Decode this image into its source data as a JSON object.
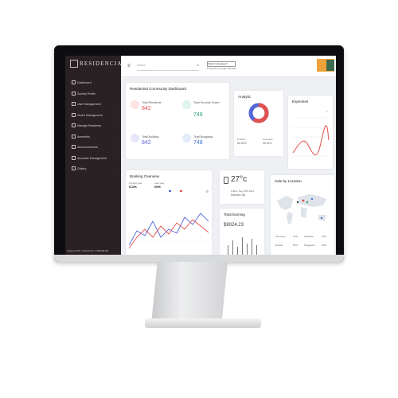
{
  "colors": {
    "sidebar": "#2a2124",
    "accent_red": "#e0524f",
    "accent_green": "#2fa87b",
    "accent_blue": "#3d73d8",
    "donut_red": "#e0524f",
    "donut_blue": "#5468d8"
  },
  "app": {
    "name": "RESIDENCIA"
  },
  "sidebar": {
    "items": [
      {
        "label": "Dashboard"
      },
      {
        "label": "Society Profile"
      },
      {
        "label": "User Management"
      },
      {
        "label": "Visitor Management"
      },
      {
        "label": "Manage Residents"
      },
      {
        "label": "Amenities"
      },
      {
        "label": "Announcements"
      },
      {
        "label": "Accounts Management"
      },
      {
        "label": "Gallery"
      }
    ],
    "support": "Support 24/7, Contact No: 7309000100"
  },
  "topbar": {
    "search_placeholder": "Search",
    "language": "Select Language ▾",
    "powered_by": "Powered by Google Translate"
  },
  "dashboard": {
    "title": "Residential Community Dashboard",
    "stats": [
      {
        "label": "Total Residents",
        "value": "842"
      },
      {
        "label": "Total Security Guard",
        "value": "748"
      },
      {
        "label": "Total Building",
        "value": "842"
      },
      {
        "label": "Total Bungalow",
        "value": "748"
      }
    ]
  },
  "analytic": {
    "title": "Analytic",
    "left_label": "Product",
    "left_value": "60.01%",
    "right_label": "Overview",
    "right_value": "30.01%",
    "left_fraction": 0.6
  },
  "expenses": {
    "title": "Expenses"
  },
  "booking": {
    "title": "Booking Overview",
    "current_label": "Current year",
    "current_value": "$125K",
    "last_label": "Last year",
    "last_value": "$59K"
  },
  "weather": {
    "temp": "27°c",
    "date": "Friday, Sep 20th 2021",
    "city": "Kansas City"
  },
  "earning": {
    "title": "Total Earning",
    "value": "$9024.23"
  },
  "sale": {
    "title": "Sale by Location",
    "rows": [
      {
        "name": "Germany",
        "value": "75%"
      },
      {
        "name": "Australia",
        "value": "75%"
      },
      {
        "name": "Russia",
        "value": "60%"
      },
      {
        "name": "Singapore",
        "value": "60%"
      }
    ]
  }
}
